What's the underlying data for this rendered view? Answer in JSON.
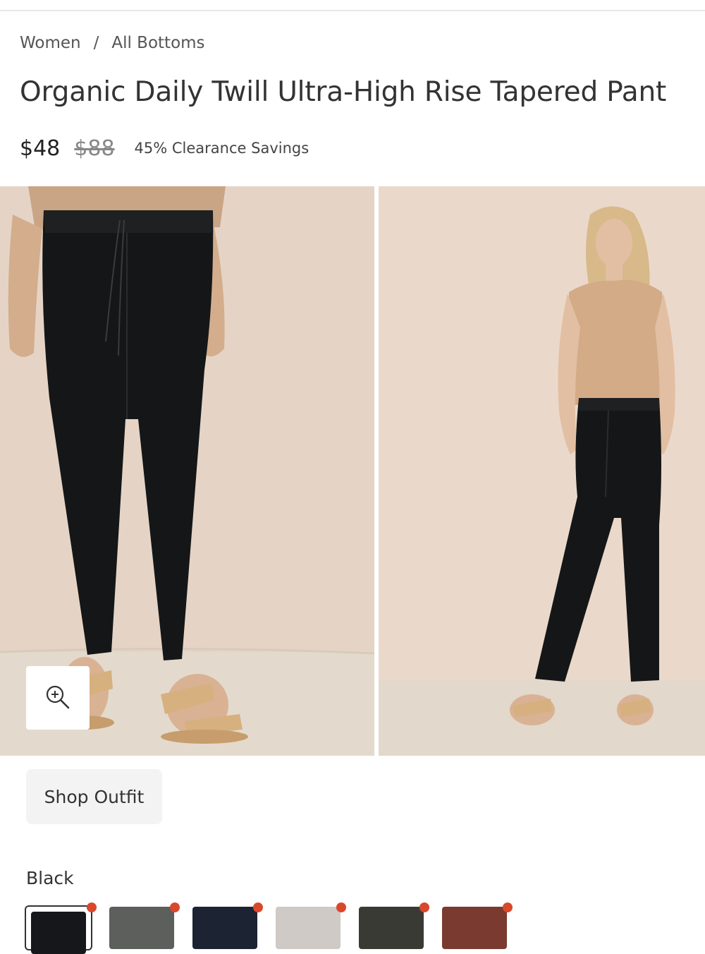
{
  "breadcrumb": {
    "items": [
      "Women",
      "All Bottoms"
    ],
    "separator": "/"
  },
  "product": {
    "title": "Organic Daily Twill Ultra-High Rise Tapered Pant",
    "price": "$48",
    "original_price": "$88",
    "savings": "45% Clearance Savings"
  },
  "gallery": {
    "zoom_icon": "zoom-in-icon"
  },
  "shop_outfit_label": "Shop Outfit",
  "color": {
    "selected_name": "Black",
    "swatches": [
      {
        "color": "#15171a",
        "selected": true
      },
      {
        "color": "#5c5f5c",
        "selected": false
      },
      {
        "color": "#1c2433",
        "selected": false
      },
      {
        "color": "#cfcac5",
        "selected": false
      },
      {
        "color": "#3a3a34",
        "selected": false
      },
      {
        "color": "#7a3a30",
        "selected": false
      }
    ],
    "indicator_color": "#d9482b"
  }
}
